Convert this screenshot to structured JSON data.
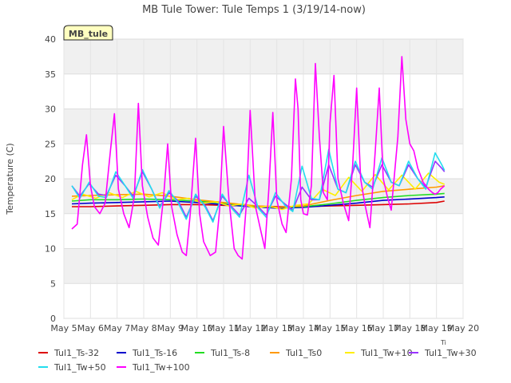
{
  "chart_data": {
    "type": "line",
    "title": "MB Tule Tower: Tule Temps 1 (3/19/14-now)",
    "badge": "MB_tule",
    "ylabel": "Temperature (C)",
    "xlabel": "",
    "corner_note": "Ti",
    "ylim": [
      0,
      40
    ],
    "xlim": [
      5,
      20
    ],
    "yticks": [
      0,
      5,
      10,
      15,
      20,
      25,
      30,
      35,
      40
    ],
    "xticks": [
      {
        "v": 5,
        "label": "May 5"
      },
      {
        "v": 6,
        "label": "May 6"
      },
      {
        "v": 7,
        "label": "May 7"
      },
      {
        "v": 8,
        "label": "May 8"
      },
      {
        "v": 9,
        "label": "May 9"
      },
      {
        "v": 10,
        "label": "May 10"
      },
      {
        "v": 11,
        "label": "May 11"
      },
      {
        "v": 12,
        "label": "May 12"
      },
      {
        "v": 13,
        "label": "May 13"
      },
      {
        "v": 14,
        "label": "May 14"
      },
      {
        "v": 15,
        "label": "May 15"
      },
      {
        "v": 16,
        "label": "May 16"
      },
      {
        "v": 17,
        "label": "May 17"
      },
      {
        "v": 18,
        "label": "May 18"
      },
      {
        "v": 19,
        "label": "May 19"
      },
      {
        "v": 20,
        "label": "May 20"
      }
    ],
    "grid": true,
    "legend_position": "bottom",
    "series": [
      {
        "name": "Tul1_Ts-32",
        "color": "#dd0000",
        "x": [
          5.3,
          6,
          7,
          8,
          9,
          10,
          11,
          12,
          13,
          14,
          15,
          16,
          17,
          18,
          19,
          19.3
        ],
        "y": [
          16.0,
          16.0,
          16.1,
          16.2,
          16.3,
          16.3,
          16.2,
          16.1,
          16.0,
          16.0,
          16.1,
          16.2,
          16.3,
          16.4,
          16.6,
          16.8
        ]
      },
      {
        "name": "Tul1_Ts-16",
        "color": "#0000cc",
        "x": [
          5.3,
          6,
          7,
          8,
          9,
          10,
          11,
          12,
          13,
          14,
          15,
          16,
          17,
          18,
          19,
          19.3
        ],
        "y": [
          16.4,
          16.5,
          16.6,
          16.7,
          16.8,
          16.6,
          16.3,
          16.0,
          15.8,
          15.9,
          16.2,
          16.5,
          16.9,
          17.1,
          17.3,
          17.4
        ]
      },
      {
        "name": "Tul1_Ts-8",
        "color": "#22dd22",
        "x": [
          5.3,
          6,
          7,
          8,
          9,
          10,
          11,
          12,
          13,
          14,
          15,
          16,
          17,
          18,
          19,
          19.3
        ],
        "y": [
          16.8,
          17.0,
          17.0,
          17.1,
          17.0,
          16.8,
          16.5,
          16.1,
          15.9,
          16.0,
          16.4,
          16.9,
          17.3,
          17.6,
          17.8,
          17.9
        ]
      },
      {
        "name": "Tul1_Ts0",
        "color": "#ff9900",
        "x": [
          5.3,
          6,
          7,
          8,
          9,
          10,
          11,
          12,
          13,
          14,
          15,
          16,
          17,
          18,
          19,
          19.3
        ],
        "y": [
          17.5,
          17.6,
          17.7,
          17.8,
          17.5,
          17.0,
          16.6,
          16.2,
          15.9,
          16.1,
          16.9,
          17.6,
          18.2,
          18.5,
          18.8,
          19.0
        ]
      },
      {
        "name": "Tul1_Tw+10",
        "color": "#ffee00",
        "x": [
          5.3,
          5.7,
          6.2,
          6.7,
          7.2,
          7.7,
          8.2,
          8.7,
          9.2,
          9.7,
          10.2,
          10.7,
          11.2,
          11.7,
          12.2,
          12.7,
          13.2,
          13.7,
          14.2,
          14.7,
          15.2,
          15.7,
          16.2,
          16.7,
          17.2,
          17.7,
          18.2,
          18.7,
          19.1,
          19.3
        ],
        "y": [
          17.0,
          17.8,
          17.2,
          18.0,
          17.3,
          18.2,
          17.4,
          18.0,
          17.0,
          17.2,
          16.5,
          16.7,
          16.1,
          16.4,
          15.8,
          16.1,
          15.6,
          16.2,
          16.4,
          18.5,
          17.6,
          20.2,
          18.2,
          20.6,
          18.4,
          20.5,
          18.5,
          20.8,
          19.5,
          19.2
        ]
      },
      {
        "name": "Tul1_Tw+30",
        "color": "#9933ff",
        "x": [
          5.3,
          5.6,
          5.95,
          6.3,
          6.6,
          6.95,
          7.3,
          7.6,
          7.95,
          8.3,
          8.6,
          8.95,
          9.3,
          9.6,
          9.95,
          10.3,
          10.6,
          10.95,
          11.3,
          11.6,
          11.95,
          12.3,
          12.6,
          12.95,
          13.3,
          13.6,
          13.95,
          14.3,
          14.6,
          14.95,
          15.3,
          15.6,
          15.95,
          16.3,
          16.6,
          16.95,
          17.3,
          17.6,
          17.95,
          18.3,
          18.6,
          18.95,
          19.2,
          19.3
        ],
        "y": [
          19.0,
          17.5,
          19.3,
          17.8,
          17.6,
          20.5,
          19.0,
          17.5,
          21.0,
          18.5,
          16.0,
          18.0,
          16.8,
          14.5,
          17.5,
          16.2,
          14.0,
          17.5,
          16.0,
          14.8,
          17.2,
          16.0,
          14.8,
          17.5,
          16.4,
          15.5,
          18.8,
          17.0,
          17.0,
          22.0,
          18.5,
          18.0,
          22.0,
          19.5,
          18.8,
          22.0,
          19.5,
          19.0,
          22.0,
          20.0,
          18.8,
          22.5,
          21.5,
          21.0
        ]
      },
      {
        "name": "Tul1_Tw+50",
        "color": "#22ddee",
        "x": [
          5.3,
          5.6,
          5.95,
          6.3,
          6.6,
          6.95,
          7.3,
          7.6,
          7.95,
          8.3,
          8.6,
          8.95,
          9.3,
          9.6,
          9.95,
          10.3,
          10.6,
          10.95,
          11.3,
          11.6,
          11.95,
          12.3,
          12.6,
          12.95,
          13.3,
          13.6,
          13.95,
          14.3,
          14.6,
          14.95,
          15.3,
          15.6,
          15.95,
          16.3,
          16.6,
          16.95,
          17.3,
          17.6,
          17.95,
          18.3,
          18.6,
          18.95,
          19.2,
          19.3
        ],
        "y": [
          19.0,
          17.2,
          19.5,
          17.5,
          17.3,
          21.0,
          19.0,
          17.2,
          21.3,
          18.5,
          15.8,
          18.3,
          16.5,
          14.2,
          17.8,
          16.0,
          13.8,
          17.8,
          15.8,
          14.5,
          20.5,
          15.8,
          14.5,
          18.0,
          16.2,
          15.3,
          21.8,
          17.2,
          17.0,
          24.2,
          18.5,
          18.0,
          22.5,
          19.5,
          18.5,
          23.0,
          19.5,
          19.0,
          22.5,
          20.0,
          18.5,
          23.7,
          22.0,
          21.2
        ]
      },
      {
        "name": "Tul1_Tw+100",
        "color": "#ff00ff",
        "x": [
          5.3,
          5.5,
          5.7,
          5.85,
          6.0,
          6.15,
          6.35,
          6.55,
          6.75,
          6.9,
          7.05,
          7.25,
          7.45,
          7.65,
          7.8,
          7.95,
          8.15,
          8.35,
          8.55,
          8.75,
          8.9,
          9.05,
          9.25,
          9.45,
          9.6,
          9.75,
          9.95,
          10.1,
          10.25,
          10.5,
          10.7,
          10.85,
          11.0,
          11.2,
          11.4,
          11.55,
          11.7,
          11.85,
          12.0,
          12.2,
          12.4,
          12.55,
          12.7,
          12.85,
          13.0,
          13.2,
          13.35,
          13.55,
          13.7,
          13.8,
          13.9,
          14.0,
          14.15,
          14.3,
          14.45,
          14.6,
          14.75,
          14.9,
          15.0,
          15.15,
          15.3,
          15.5,
          15.7,
          15.85,
          16.0,
          16.15,
          16.3,
          16.5,
          16.7,
          16.85,
          17.0,
          17.15,
          17.3,
          17.55,
          17.7,
          17.85,
          18.0,
          18.15,
          18.3,
          18.5,
          18.7,
          18.85,
          18.95,
          19.05,
          19.15,
          19.3
        ],
        "y": [
          12.8,
          13.5,
          22.0,
          26.3,
          19.0,
          16.0,
          15.0,
          16.5,
          24.0,
          29.3,
          18.5,
          15.0,
          13.0,
          17.5,
          30.8,
          19.0,
          14.5,
          11.5,
          10.5,
          17.5,
          25.0,
          16.0,
          12.0,
          9.5,
          9.0,
          15.0,
          25.8,
          15.0,
          11.0,
          9.0,
          9.5,
          15.5,
          27.5,
          17.0,
          10.0,
          9.0,
          8.5,
          16.0,
          29.8,
          16.0,
          12.5,
          10.0,
          18.5,
          29.5,
          17.0,
          13.5,
          12.3,
          20.0,
          34.3,
          30.0,
          17.0,
          15.0,
          14.8,
          19.0,
          36.5,
          26.0,
          18.0,
          17.0,
          28.0,
          34.8,
          20.0,
          16.5,
          14.0,
          22.0,
          33.0,
          20.0,
          16.5,
          13.0,
          24.0,
          33.0,
          20.0,
          17.5,
          15.5,
          26.0,
          37.5,
          28.5,
          25.0,
          24.0,
          21.5,
          19.5,
          18.5,
          18.0,
          17.8,
          18.0,
          18.5,
          19.0
        ]
      }
    ]
  }
}
